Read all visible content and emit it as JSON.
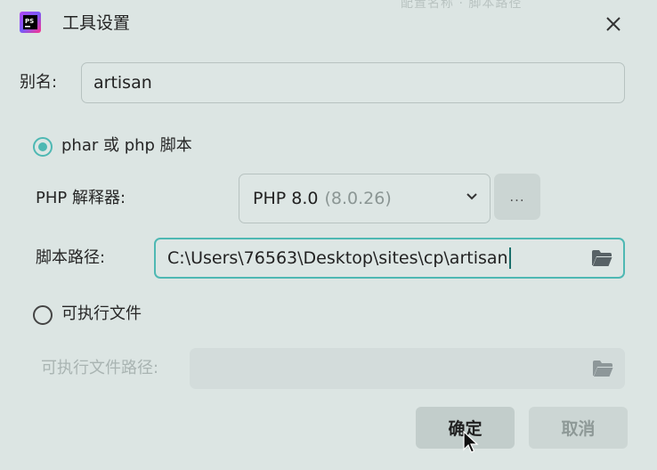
{
  "window": {
    "title": "工具设置",
    "background_hint": "配置名称 · 脚本路径"
  },
  "form": {
    "alias_label": "别名:",
    "alias_value": "artisan",
    "phar_option_label": "phar 或 php 脚本",
    "phar_option_checked": true,
    "interpreter_label": "PHP 解释器:",
    "interpreter_name": "PHP 8.0",
    "interpreter_version": "(8.0.26)",
    "interpreter_more": "...",
    "script_path_label": "脚本路径:",
    "script_path_value": "C:\\Users\\76563\\Desktop\\sites\\cp\\artisan",
    "executable_option_label": "可执行文件",
    "executable_option_checked": false,
    "executable_path_label": "可执行文件路径:",
    "executable_path_value": ""
  },
  "buttons": {
    "ok": "确定",
    "cancel": "取消"
  },
  "colors": {
    "accent": "#4eb8b3",
    "dialog_bg": "#dce5e3"
  },
  "icons": {
    "app": "phpstorm-logo-icon",
    "close": "close-icon",
    "folder": "folder-icon",
    "chevron": "chevron-down-icon"
  }
}
